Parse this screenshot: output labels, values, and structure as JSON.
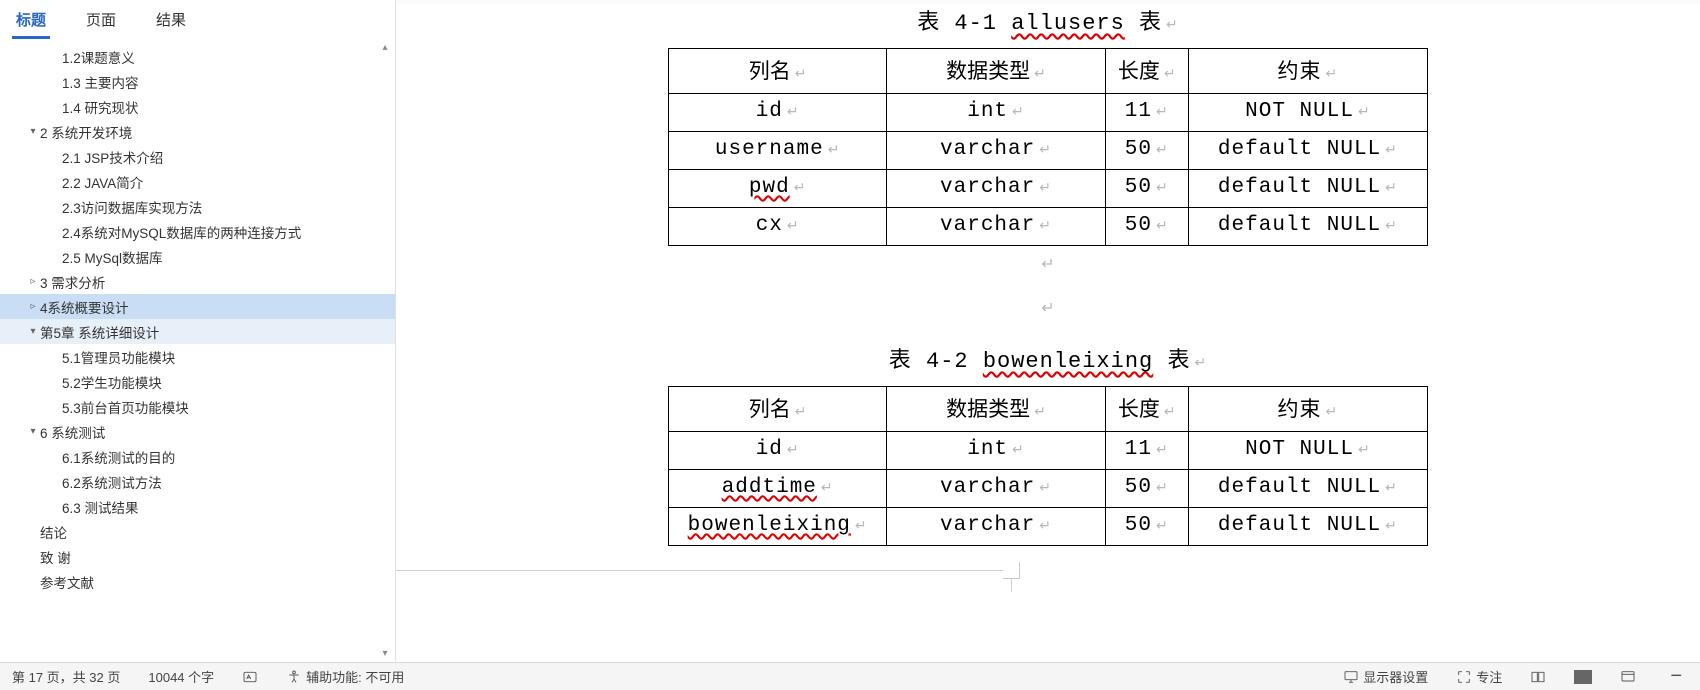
{
  "nav": {
    "tabs": [
      "标题",
      "页面",
      "结果"
    ],
    "activeTab": 0,
    "items": [
      {
        "depth": 2,
        "caret": "",
        "label": "1.2课题意义"
      },
      {
        "depth": 2,
        "caret": "",
        "label": "1.3 主要内容"
      },
      {
        "depth": 2,
        "caret": "",
        "label": "1.4 研究现状"
      },
      {
        "depth": 1,
        "caret": "▾",
        "label": "2 系统开发环境"
      },
      {
        "depth": 2,
        "caret": "",
        "label": "2.1 JSP技术介绍"
      },
      {
        "depth": 2,
        "caret": "",
        "label": "2.2 JAVA简介"
      },
      {
        "depth": 2,
        "caret": "",
        "label": "2.3访问数据库实现方法"
      },
      {
        "depth": 2,
        "caret": "",
        "label": "2.4系统对MySQL数据库的两种连接方式"
      },
      {
        "depth": 2,
        "caret": "",
        "label": "2.5 MySql数据库"
      },
      {
        "depth": 1,
        "caret": "▹",
        "label": "3 需求分析"
      },
      {
        "depth": 1,
        "caret": "▹",
        "label": "4系统概要设计",
        "selected": true
      },
      {
        "depth": 1,
        "caret": "▾",
        "label": "第5章 系统详细设计",
        "open": true
      },
      {
        "depth": 2,
        "caret": "",
        "label": "5.1管理员功能模块"
      },
      {
        "depth": 2,
        "caret": "",
        "label": "5.2学生功能模块"
      },
      {
        "depth": 2,
        "caret": "",
        "label": "5.3前台首页功能模块"
      },
      {
        "depth": 1,
        "caret": "▾",
        "label": "6 系统测试"
      },
      {
        "depth": 2,
        "caret": "",
        "label": "6.1系统测试的目的"
      },
      {
        "depth": 2,
        "caret": "",
        "label": "6.2系统测试方法"
      },
      {
        "depth": 2,
        "caret": "",
        "label": "6.3 测试结果"
      },
      {
        "depth": 1,
        "caret": "",
        "label": "结论"
      },
      {
        "depth": 1,
        "caret": "",
        "label": "致 谢"
      },
      {
        "depth": 1,
        "caret": "",
        "label": "参考文献"
      }
    ]
  },
  "doc": {
    "tables": [
      {
        "caption_prefix": "表 4-1 ",
        "caption_name": "allusers",
        "caption_suffix": " 表",
        "headers": [
          "列名",
          "数据类型",
          "长度",
          "约束"
        ],
        "rows": [
          {
            "name": "id",
            "type": "int",
            "len": "11",
            "cons": "NOT NULL",
            "spell": false
          },
          {
            "name": "username",
            "type": "varchar",
            "len": "50",
            "cons": "default NULL",
            "spell": false
          },
          {
            "name": "pwd",
            "type": "varchar",
            "len": "50",
            "cons": "default NULL",
            "spell": true
          },
          {
            "name": "cx",
            "type": "varchar",
            "len": "50",
            "cons": "default NULL",
            "spell": false
          }
        ]
      },
      {
        "caption_prefix": "表 4-2 ",
        "caption_name": "bowenleixing",
        "caption_suffix": " 表",
        "headers": [
          "列名",
          "数据类型",
          "长度",
          "约束"
        ],
        "rows": [
          {
            "name": "id",
            "type": "int",
            "len": "11",
            "cons": "NOT NULL",
            "spell": false
          },
          {
            "name": "addtime",
            "type": "varchar",
            "len": "50",
            "cons": "default NULL",
            "spell": true
          },
          {
            "name": "bowenleixing",
            "type": "varchar",
            "len": "50",
            "cons": "default NULL",
            "spell": true
          }
        ]
      }
    ]
  },
  "status": {
    "page": "第 17 页，共 32 页",
    "words": "10044 个字",
    "a11y": "辅助功能: 不可用",
    "display": "显示器设置",
    "focus": "专注"
  }
}
